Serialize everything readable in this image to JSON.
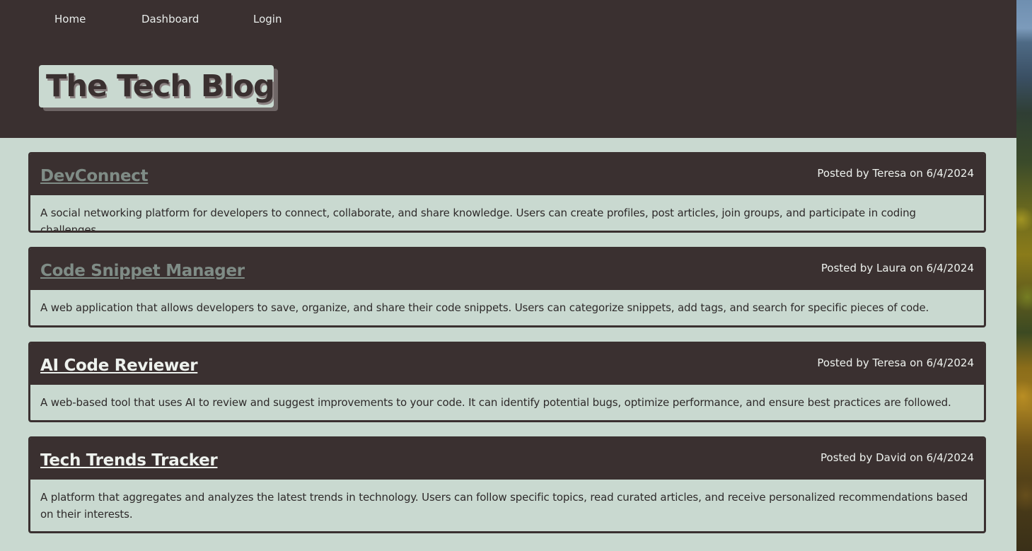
{
  "nav": {
    "home": "Home",
    "dashboard": "Dashboard",
    "login": "Login"
  },
  "site": {
    "title": "The Tech Blog"
  },
  "posts": [
    {
      "title": "DevConnect",
      "meta": "Posted by Teresa on 6/4/2024",
      "body": "A social networking platform for developers to connect, collaborate, and share knowledge. Users can create profiles, post articles, join groups, and participate in coding challenges."
    },
    {
      "title": "Code Snippet Manager",
      "meta": "Posted by Laura on 6/4/2024",
      "body": "A web application that allows developers to save, organize, and share their code snippets. Users can categorize snippets, add tags, and search for specific pieces of code."
    },
    {
      "title": "AI Code Reviewer",
      "meta": "Posted by Teresa on 6/4/2024",
      "body": "A web-based tool that uses AI to review and suggest improvements to your code. It can identify potential bugs, optimize performance, and ensure best practices are followed."
    },
    {
      "title": "Tech Trends Tracker",
      "meta": "Posted by David on 6/4/2024",
      "body": "A platform that aggregates and analyzes the latest trends in technology. Users can follow specific topics, read curated articles, and receive personalized recommendations based on their interests."
    }
  ],
  "colors": {
    "header_bg": "#3a3030",
    "page_bg": "#c9d9d0",
    "visited_link": "#7f8c86",
    "link_text": "#eef2ee"
  }
}
